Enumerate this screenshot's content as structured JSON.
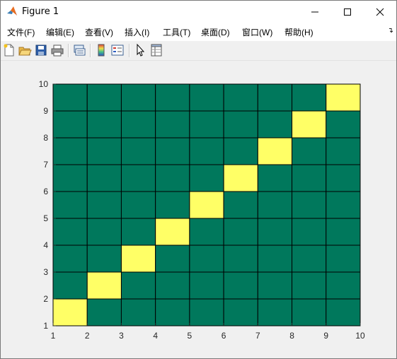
{
  "window": {
    "title": "Figure 1",
    "icon": "matlab-icon"
  },
  "menu": {
    "items": [
      {
        "label": "文件(F)",
        "name": "menu-file"
      },
      {
        "label": "编辑(E)",
        "name": "menu-edit"
      },
      {
        "label": "查看(V)",
        "name": "menu-view"
      },
      {
        "label": "插入(I)",
        "name": "menu-insert"
      },
      {
        "label": "工具(T)",
        "name": "menu-tools"
      },
      {
        "label": "桌面(D)",
        "name": "menu-desktop"
      },
      {
        "label": "窗口(W)",
        "name": "menu-window"
      },
      {
        "label": "帮助(H)",
        "name": "menu-help"
      }
    ],
    "overflow_icon": "chevron-more-icon"
  },
  "toolbar": {
    "buttons": [
      "new-figure-icon",
      "open-file-icon",
      "save-icon",
      "print-icon",
      "link-plot-icon",
      "insert-colorbar-icon",
      "insert-legend-icon",
      "pointer-icon",
      "property-inspector-icon"
    ]
  },
  "chart_data": {
    "type": "heatmap",
    "title": "",
    "xlabel": "",
    "ylabel": "",
    "xlim": [
      1,
      10
    ],
    "ylim": [
      1,
      10
    ],
    "x_ticks": [
      "1",
      "2",
      "3",
      "4",
      "5",
      "6",
      "7",
      "8",
      "9",
      "10"
    ],
    "y_ticks": [
      "1",
      "2",
      "3",
      "4",
      "5",
      "6",
      "7",
      "8",
      "9",
      "10"
    ],
    "colors": {
      "low": "#00785c",
      "high": "#ffff66",
      "grid": "#000000"
    },
    "values": [
      [
        1,
        0,
        0,
        0,
        0,
        0,
        0,
        0,
        0
      ],
      [
        0,
        1,
        0,
        0,
        0,
        0,
        0,
        0,
        0
      ],
      [
        0,
        0,
        1,
        0,
        0,
        0,
        0,
        0,
        0
      ],
      [
        0,
        0,
        0,
        1,
        0,
        0,
        0,
        0,
        0
      ],
      [
        0,
        0,
        0,
        0,
        1,
        0,
        0,
        0,
        0
      ],
      [
        0,
        0,
        0,
        0,
        0,
        1,
        0,
        0,
        0
      ],
      [
        0,
        0,
        0,
        0,
        0,
        0,
        1,
        0,
        0
      ],
      [
        0,
        0,
        0,
        0,
        0,
        0,
        0,
        1,
        0
      ],
      [
        0,
        0,
        0,
        0,
        0,
        0,
        0,
        0,
        1
      ]
    ]
  }
}
